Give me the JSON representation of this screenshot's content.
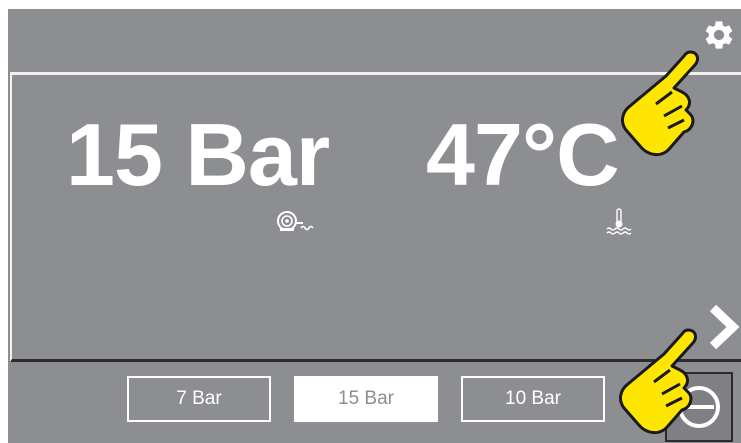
{
  "readouts": {
    "pressure": "15 Bar",
    "temperature": "47°C"
  },
  "presets": [
    {
      "label": "7 Bar",
      "selected": false
    },
    {
      "label": "15 Bar",
      "selected": true
    },
    {
      "label": "10 Bar",
      "selected": false
    }
  ],
  "icons": {
    "settings": "gear-icon",
    "pressure": "pump-icon",
    "temperature": "water-temperature-icon",
    "next": "chevron-right-icon",
    "power": "power-icon",
    "hint": "pointing-hand-icon"
  },
  "colors": {
    "background": "#8d8e91",
    "text": "#ffffff",
    "highlight": "#ffe600"
  }
}
